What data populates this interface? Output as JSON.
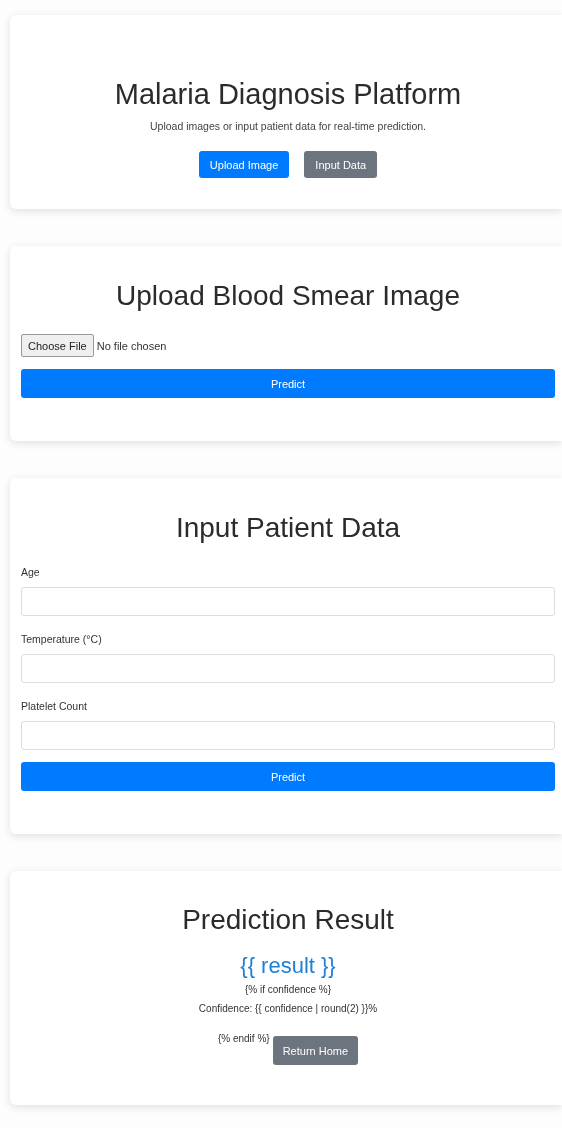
{
  "header": {
    "title": "Malaria Diagnosis Platform",
    "subtitle": "Upload images or input patient data for real-time prediction.",
    "buttons": [
      {
        "label": "Upload Image",
        "kind": "primary"
      },
      {
        "label": "Input Data",
        "kind": "secondary"
      }
    ]
  },
  "upload_section": {
    "title": "Upload Blood Smear Image",
    "file_input": {
      "button": "Choose File",
      "status": "No file chosen"
    },
    "submit": {
      "label": "Predict",
      "kind": "primary"
    }
  },
  "data_section": {
    "title": "Input Patient Data",
    "fields": [
      {
        "label": "Age"
      },
      {
        "label": "Temperature (°C)"
      },
      {
        "label": "Platelet Count"
      }
    ],
    "submit": {
      "label": "Predict",
      "kind": "primary"
    }
  },
  "result_section": {
    "title": "Prediction Result",
    "result": "{{ result }}",
    "lines": [
      "{% if confidence %}",
      "Confidence: {{ confidence | round(2) }}%"
    ],
    "trailing_text": "{% endif %}",
    "button": {
      "label": "Return Home",
      "kind": "secondary"
    }
  }
}
